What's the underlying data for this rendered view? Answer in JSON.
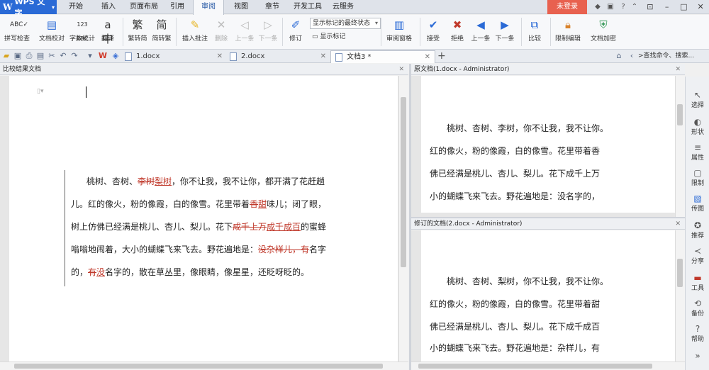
{
  "app": {
    "logo": "W",
    "name": "WPS 文字",
    "dropdown": "▾"
  },
  "menu": {
    "items": [
      "开始",
      "插入",
      "页面布局",
      "引用",
      "审阅",
      "视图",
      "章节",
      "开发工具",
      "云服务"
    ],
    "active": "审阅",
    "login": "未登录"
  },
  "ribbon": {
    "spellcheck": "拼写检查",
    "proofread": "文档校对",
    "wordcount": "字数统计",
    "translate": "翻译",
    "to_simplified": "繁转简",
    "to_traditional": "简转繁",
    "insert_comment": "插入批注",
    "delete": "删除",
    "prev": "上一条",
    "next": "下一条",
    "revise": "修订",
    "mark_state": "显示标记的最终状态",
    "show_marks": "显示标记",
    "review_pane": "审阅窗格",
    "accept": "接受",
    "reject": "拒绝",
    "prev2": "上一条",
    "next2": "下一条",
    "compare": "比较",
    "restrict_edit": "限制编辑",
    "encrypt": "文档加密"
  },
  "tabs": [
    {
      "label": "1.docx"
    },
    {
      "label": "2.docx"
    },
    {
      "label": "文档3 *"
    }
  ],
  "command_search": "查找命令、搜索...",
  "left_pane": {
    "title": "比较结果文档",
    "paragraph": [
      [
        [
          "n",
          "桃树、杏树、"
        ],
        [
          "d",
          "李树"
        ],
        [
          "i",
          "梨树"
        ],
        [
          "n",
          "，你不让我，我不让你，都开满了花赶趟"
        ]
      ],
      [
        [
          "n",
          "儿。红的像火，粉的像霞，白的像雪。花里带着"
        ],
        [
          "d",
          "香"
        ],
        [
          "i",
          "甜"
        ],
        [
          "n",
          "味儿；闭了眼，"
        ]
      ],
      [
        [
          "n",
          "树上仿佛已经满是桃儿、杏儿、梨儿。花下"
        ],
        [
          "d",
          "成千上万"
        ],
        [
          "i",
          "成千成百"
        ],
        [
          "n",
          "的蜜蜂"
        ]
      ],
      [
        [
          "n",
          "嗡嗡地闹着，大小的蝴蝶飞来飞去。野花遍地是："
        ],
        [
          "d",
          "没杂样儿，有"
        ],
        [
          "n",
          "名字"
        ]
      ],
      [
        [
          "n",
          "的，"
        ],
        [
          "d",
          "有"
        ],
        [
          "i",
          "没"
        ],
        [
          "n",
          "名字的，散在草丛里，像眼睛，像星星，还眨呀眨的。"
        ]
      ]
    ]
  },
  "original_pane": {
    "title": "原文档(1.docx - Administrator)",
    "lines": [
      "　　桃树、杏树、李树，你不让我，我不让你。",
      "红的像火，粉的像霞，白的像雪。花里带着香",
      "佛已经满是桃儿、杏儿、梨儿。花下成千上万",
      "小的蝴蝶飞来飞去。野花遍地是：没名字的，"
    ]
  },
  "revised_pane": {
    "title": "修订的文档(2.docx - Administrator)",
    "lines": [
      "　　桃树、杏树、梨树，你不让我，我不让你。",
      "红的像火，粉的像霞，白的像雪。花里带着甜",
      "佛已经满是桃儿、杏儿、梨儿。花下成千成百",
      "小的蝴蝶飞来飞去。野花遍地是：杂样儿，有"
    ]
  },
  "sidebar": [
    "选择",
    "形状",
    "属性",
    "限制",
    "传图",
    "推荐",
    "分享",
    "工具",
    "备份",
    "帮助"
  ]
}
